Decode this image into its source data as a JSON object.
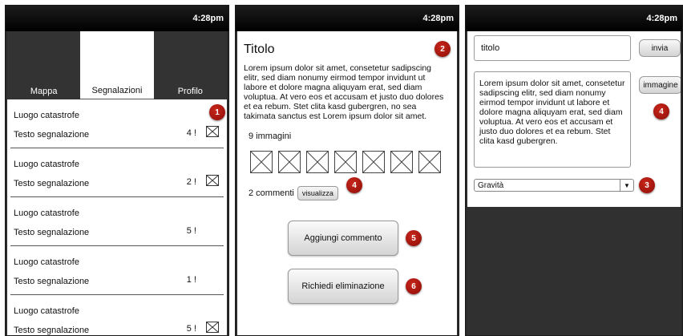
{
  "status": {
    "time": "4:28pm"
  },
  "panel1": {
    "tabs": [
      {
        "label": "Mappa"
      },
      {
        "label": "Segnalazioni"
      },
      {
        "label": "Profilo"
      }
    ],
    "badge": "1",
    "items": [
      {
        "place": "Luogo catastrofe",
        "text": "Testo segnalazione",
        "count": "4 !",
        "has_message": true
      },
      {
        "place": "Luogo catastrofe",
        "text": "Testo segnalazione",
        "count": "2 !",
        "has_message": true
      },
      {
        "place": "Luogo catastrofe",
        "text": "Testo segnalazione",
        "count": "5 !",
        "has_message": false
      },
      {
        "place": "Luogo catastrofe",
        "text": "Testo segnalazione",
        "count": "1 !",
        "has_message": false
      },
      {
        "place": "Luogo catastrofe",
        "text": "Testo segnalazione",
        "count": "5 !",
        "has_message": true
      }
    ]
  },
  "panel2": {
    "title": "Titolo",
    "badge_title": "2",
    "body": "Lorem ipsum dolor sit amet, consetetur sadipscing elitr, sed diam nonumy eirmod tempor invidunt ut labore et dolore magna aliquyam erat, sed diam voluptua. At vero eos et accusam et justo duo dolores et ea rebum. Stet clita kasd gubergren, no sea takimata sanctus est Lorem ipsum dolor sit amet.",
    "image_count": "9 immagini",
    "thumb_count": 7,
    "comments": "2 commenti",
    "view_button": "visualizza",
    "badge_comments": "4",
    "add_comment": "Aggiungi commento",
    "badge_add": "5",
    "request_delete": "Richiedi eliminazione",
    "badge_delete": "6"
  },
  "panel3": {
    "title_value": "titolo",
    "send_button": "invia",
    "body_value": "Lorem ipsum dolor sit amet, consetetur sadipscing elitr, sed diam nonumy eirmod tempor invidunt ut labore et dolore magna aliquyam erat, sed diam voluptua. At vero eos et accusam et justo duo dolores et ea rebum. Stet clita kasd gubergren.",
    "image_button": "immagine",
    "badge_image": "4",
    "severity_selected": "Gravità",
    "badge_severity": "3"
  },
  "colors": {
    "badge": "#a3130b",
    "dark_bg": "#2b2b2b"
  }
}
